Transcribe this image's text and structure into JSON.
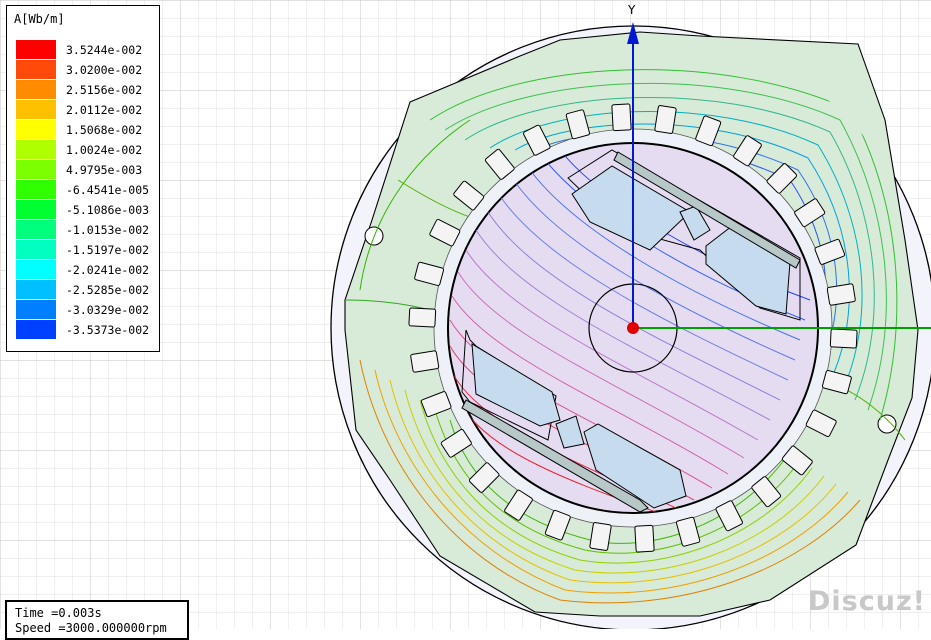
{
  "legend": {
    "title": "A[Wb/m]",
    "entries": [
      {
        "value": "3.5244e-002",
        "color": "#ff0000"
      },
      {
        "value": "3.0200e-002",
        "color": "#ff4a0a"
      },
      {
        "value": "2.5156e-002",
        "color": "#ff8c00"
      },
      {
        "value": "2.0112e-002",
        "color": "#ffc000"
      },
      {
        "value": "1.5068e-002",
        "color": "#ffff00"
      },
      {
        "value": "1.0024e-002",
        "color": "#b0ff00"
      },
      {
        "value": "4.9795e-003",
        "color": "#7cff00"
      },
      {
        "value": "-6.4541e-005",
        "color": "#30ff00"
      },
      {
        "value": "-5.1086e-003",
        "color": "#00ff30"
      },
      {
        "value": "-1.0153e-002",
        "color": "#00ff7c"
      },
      {
        "value": "-1.5197e-002",
        "color": "#00ffc0"
      },
      {
        "value": "-2.0241e-002",
        "color": "#00ffff"
      },
      {
        "value": "-2.5285e-002",
        "color": "#00c0ff"
      },
      {
        "value": "-3.0329e-002",
        "color": "#0080ff"
      },
      {
        "value": "-3.5373e-002",
        "color": "#0040ff"
      }
    ]
  },
  "info": {
    "time": "Time   =0.003s",
    "speed": "Speed  =3000.000000rpm"
  },
  "axis": {
    "y_label": "Y"
  },
  "watermark": "Discuz!",
  "colors": {
    "stator_fill": "#d8ead8",
    "rotor_fill": "#e6dcf2",
    "magnet_fill": "#c6dcee",
    "axis_green": "#00a000",
    "axis_blue": "#0018d0",
    "grid": "#d4d4d4"
  }
}
